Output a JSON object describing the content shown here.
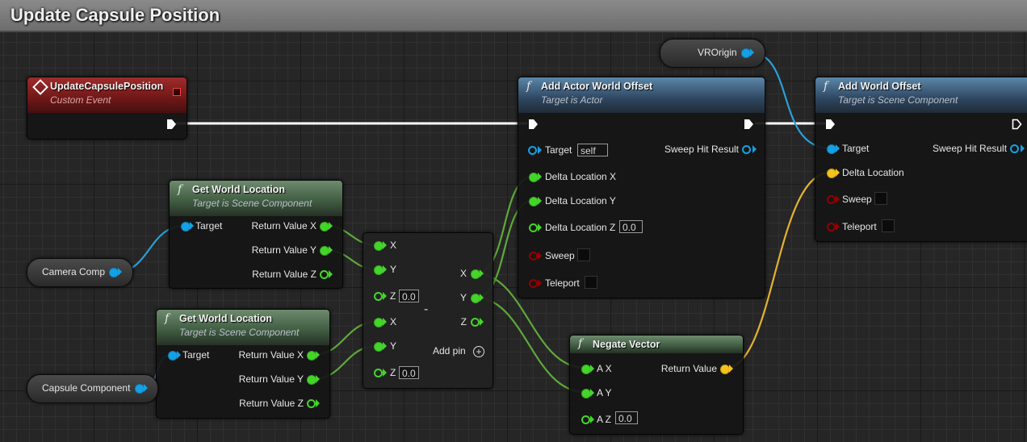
{
  "window": {
    "title": "Update Capsule Position"
  },
  "colors": {
    "exec_pin": "#ffffff",
    "object_pin": "#15a0e5",
    "float_pin": "#44d52a",
    "vector_pin": "#f6c31a",
    "bool_pin": "#930000",
    "wire_object": "#2a9fd8",
    "wire_float": "#5ea83a",
    "wire_vector": "#e3b22f"
  },
  "nodes": {
    "custom_event": {
      "title": "UpdateCapsulePosition",
      "subtitle": "Custom Event",
      "icon": "event-diamond-icon"
    },
    "get_world_location_1": {
      "title": "Get World Location",
      "subtitle": "Target is Scene Component",
      "inputs": [
        "Target"
      ],
      "outputs": [
        "Return Value X",
        "Return Value Y",
        "Return Value Z"
      ]
    },
    "get_world_location_2": {
      "title": "Get World Location",
      "subtitle": "Target is Scene Component",
      "inputs": [
        "Target"
      ],
      "outputs": [
        "Return Value X",
        "Return Value Y",
        "Return Value Z"
      ]
    },
    "subtract": {
      "symbol": "-",
      "inputs_a": [
        "X",
        "Y",
        "Z"
      ],
      "inputs_b": [
        "X",
        "Y",
        "Z"
      ],
      "z_default_a": "0.0",
      "z_default_b": "0.0",
      "outputs": [
        "X",
        "Y",
        "Z"
      ],
      "add_pin_label": "Add pin"
    },
    "add_actor_world_offset": {
      "title": "Add Actor World Offset",
      "subtitle": "Target is Actor",
      "target_label": "Target",
      "target_default": "self",
      "delta_x": "Delta Location X",
      "delta_y": "Delta Location Y",
      "delta_z": "Delta Location Z",
      "delta_z_default": "0.0",
      "sweep": "Sweep",
      "teleport": "Teleport",
      "sweep_hit_result": "Sweep Hit Result"
    },
    "add_world_offset": {
      "title": "Add World Offset",
      "subtitle": "Target is Scene Component",
      "target_label": "Target",
      "delta_location": "Delta Location",
      "sweep": "Sweep",
      "teleport": "Teleport",
      "sweep_hit_result": "Sweep Hit Result"
    },
    "negate_vector": {
      "title": "Negate Vector",
      "ax": "A X",
      "ay": "A Y",
      "az": "A Z",
      "az_default": "0.0",
      "return_value": "Return Value"
    },
    "vars": {
      "camera_comp": "Camera Comp",
      "capsule_component": "Capsule Component",
      "vr_origin": "VROrigin"
    }
  }
}
